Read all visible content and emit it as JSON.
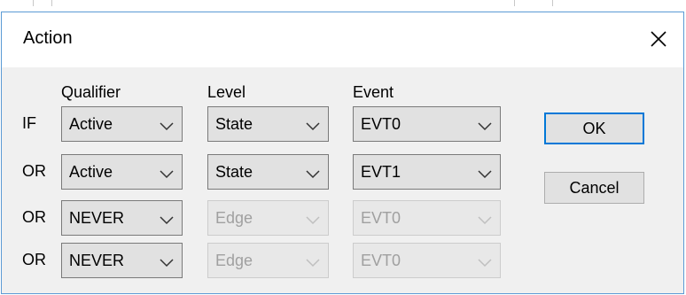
{
  "dialog": {
    "title": "Action",
    "ok_label": "OK",
    "cancel_label": "Cancel"
  },
  "headers": {
    "qualifier": "Qualifier",
    "level": "Level",
    "event": "Event"
  },
  "rows": [
    {
      "logic": "IF",
      "qualifier": "Active",
      "level": "State",
      "event": "EVT0",
      "level_enabled": true,
      "event_enabled": true
    },
    {
      "logic": "OR",
      "qualifier": "Active",
      "level": "State",
      "event": "EVT1",
      "level_enabled": true,
      "event_enabled": true
    },
    {
      "logic": "OR",
      "qualifier": "NEVER",
      "level": "Edge",
      "event": "EVT0",
      "level_enabled": false,
      "event_enabled": false
    },
    {
      "logic": "OR",
      "qualifier": "NEVER",
      "level": "Edge",
      "event": "EVT0",
      "level_enabled": false,
      "event_enabled": false
    }
  ],
  "icons": {
    "close": "close-icon",
    "dropdown": "chevron-down-icon"
  },
  "colors": {
    "dialog_border": "#5b9bd5",
    "default_button_border": "#0078d7",
    "disabled_text": "#a0a0a0"
  }
}
